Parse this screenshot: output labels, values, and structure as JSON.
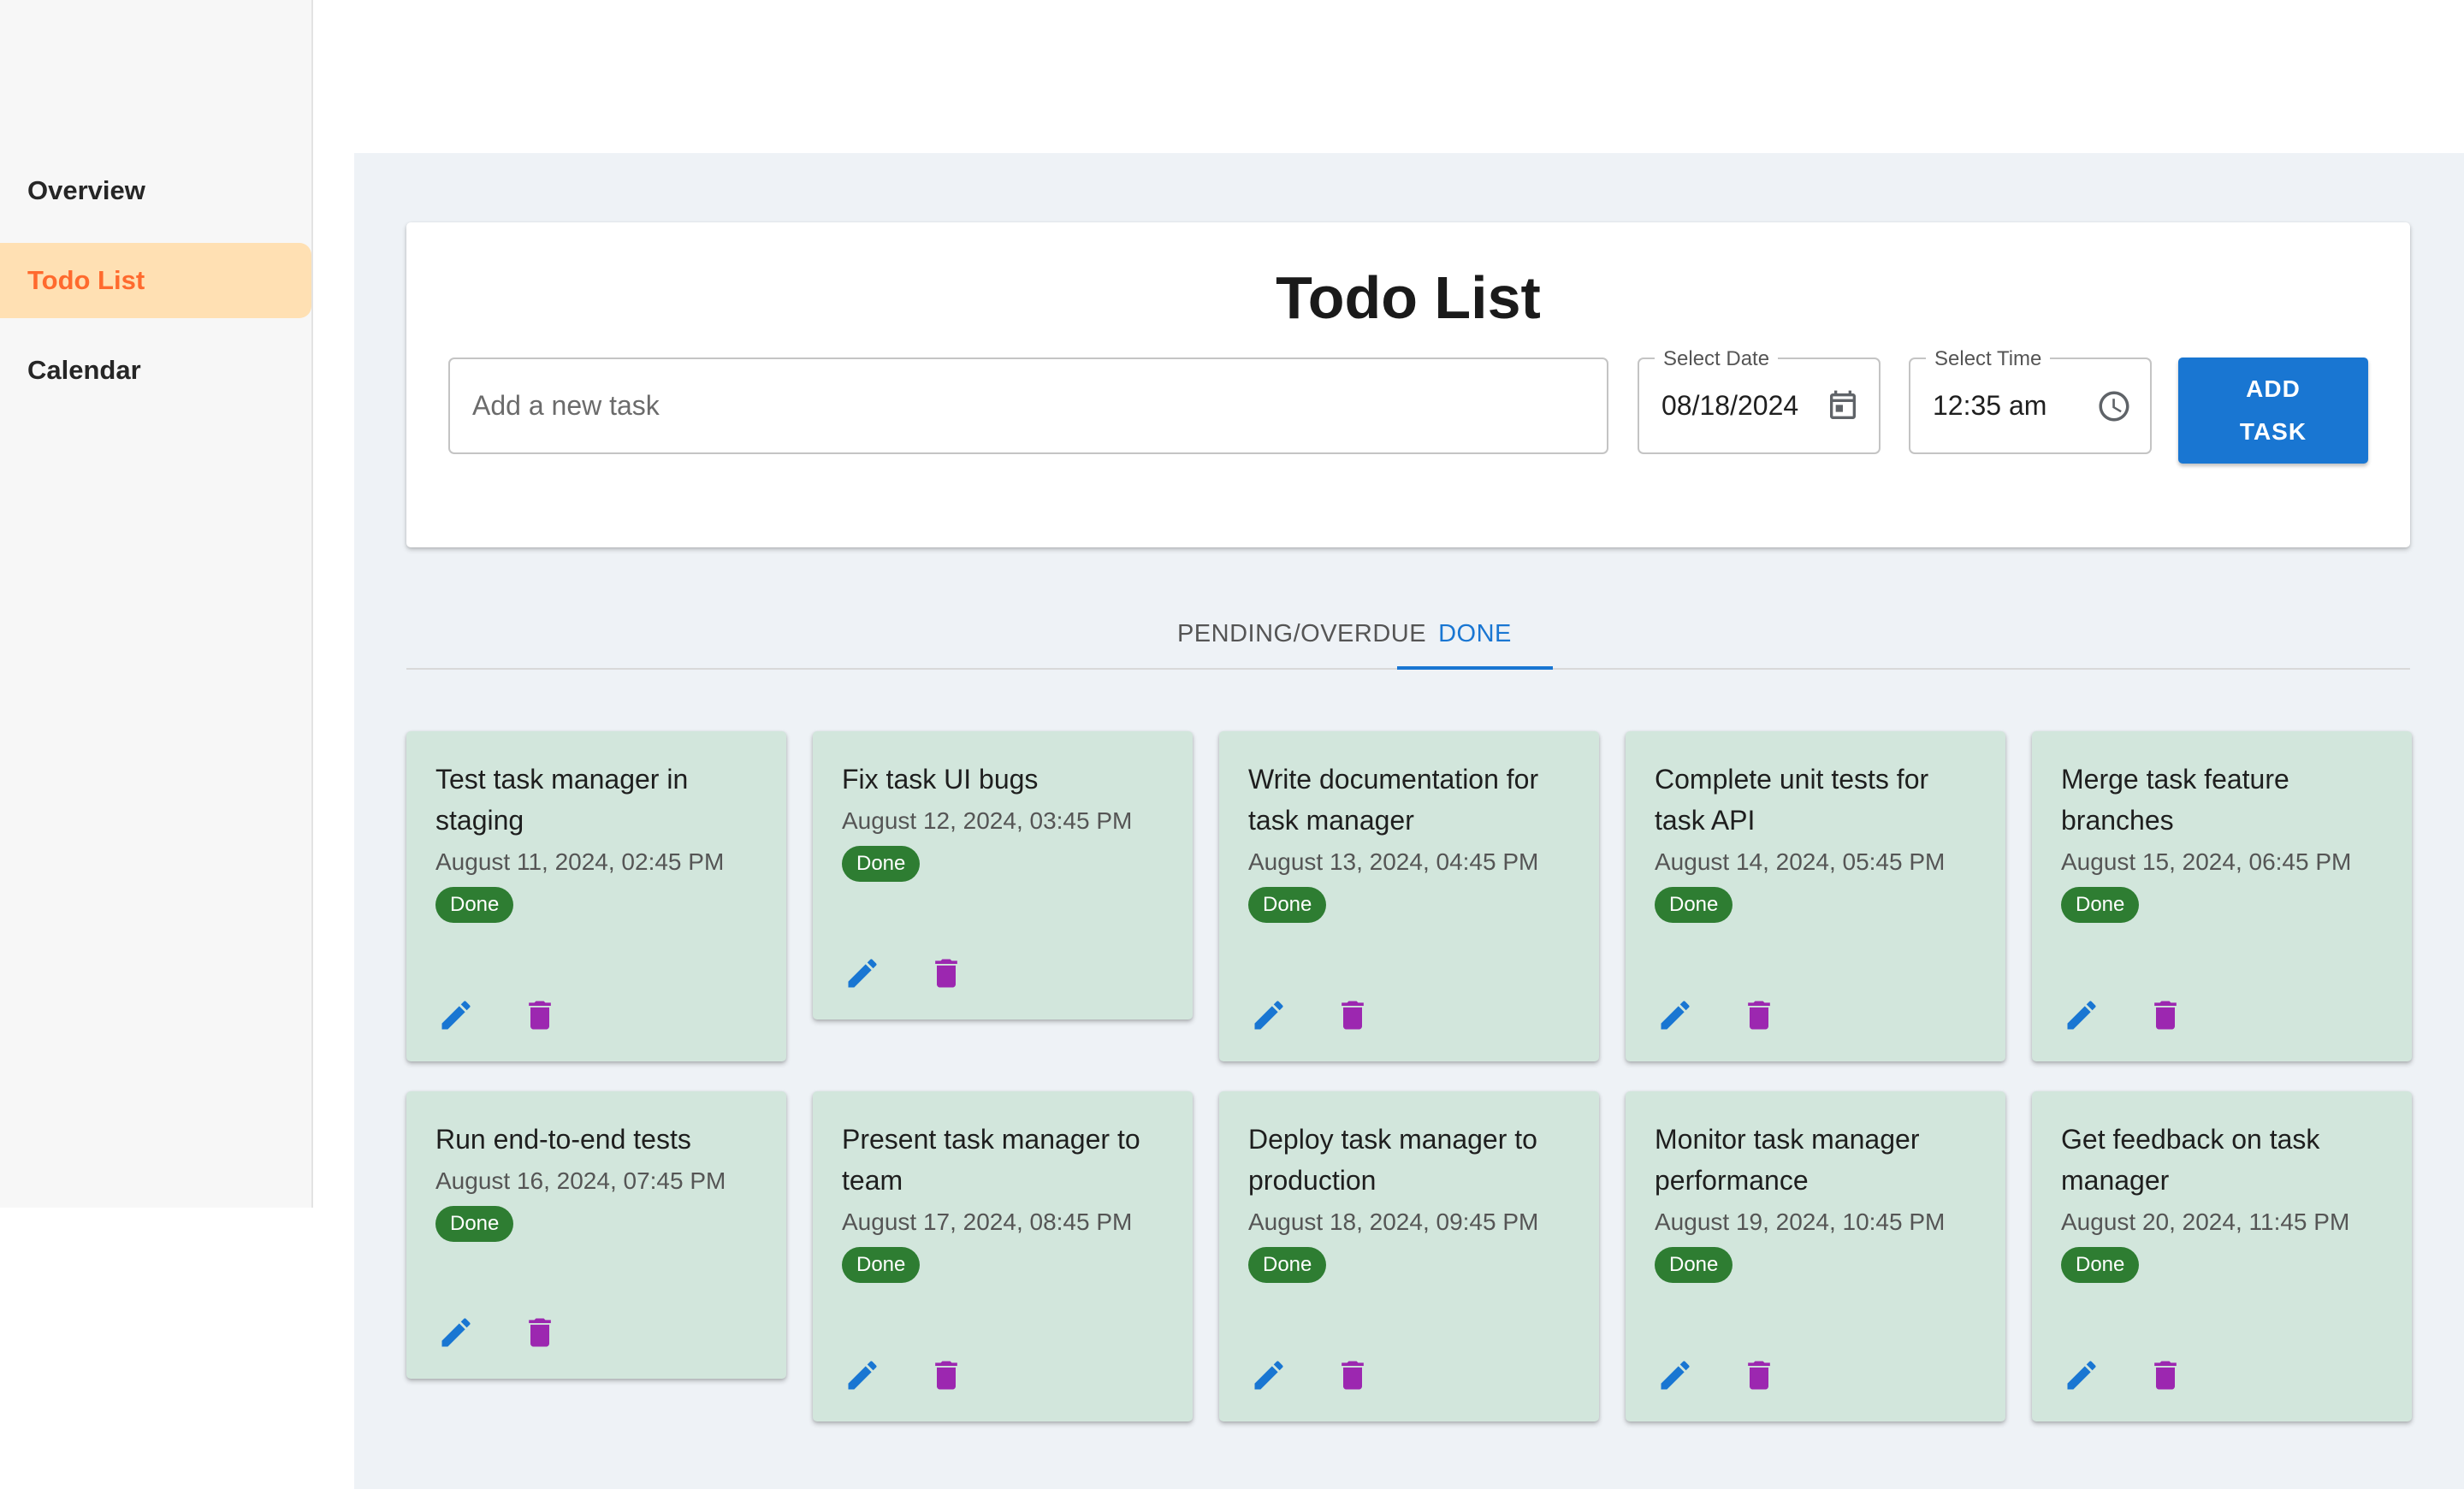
{
  "sidebar": {
    "items": [
      {
        "label": "Overview",
        "active": false
      },
      {
        "label": "Todo List",
        "active": true
      },
      {
        "label": "Calendar",
        "active": false
      }
    ]
  },
  "header": {
    "title": "Todo List",
    "task_input_placeholder": "Add a new task",
    "date_field": {
      "label": "Select Date",
      "value": "08/18/2024",
      "icon": "calendar-icon"
    },
    "time_field": {
      "label": "Select Time",
      "value": "12:35 am",
      "icon": "clock-icon"
    },
    "add_button_label": "ADD TASK"
  },
  "tabs": [
    {
      "label": "PENDING/OVERDUE",
      "active": false
    },
    {
      "label": "DONE",
      "active": true
    }
  ],
  "tasks": [
    {
      "title": "Test task manager in staging",
      "date": "August 11, 2024, 02:45 PM",
      "status": "Done"
    },
    {
      "title": "Fix task UI bugs",
      "date": "August 12, 2024, 03:45 PM",
      "status": "Done"
    },
    {
      "title": "Write documentation for task manager",
      "date": "August 13, 2024, 04:45 PM",
      "status": "Done"
    },
    {
      "title": "Complete unit tests for task API",
      "date": "August 14, 2024, 05:45 PM",
      "status": "Done"
    },
    {
      "title": "Merge task feature branches",
      "date": "August 15, 2024, 06:45 PM",
      "status": "Done"
    },
    {
      "title": "Run end-to-end tests",
      "date": "August 16, 2024, 07:45 PM",
      "status": "Done"
    },
    {
      "title": "Present task manager to team",
      "date": "August 17, 2024, 08:45 PM",
      "status": "Done"
    },
    {
      "title": "Deploy task manager to production",
      "date": "August 18, 2024, 09:45 PM",
      "status": "Done"
    },
    {
      "title": "Monitor task manager performance",
      "date": "August 19, 2024, 10:45 PM",
      "status": "Done"
    },
    {
      "title": "Get feedback on task manager",
      "date": "August 20, 2024, 11:45 PM",
      "status": "Done"
    }
  ],
  "colors": {
    "accent": "#1976d2",
    "sidebar_active_bg": "#ffe0b3",
    "sidebar_active_text": "#ff6a2e",
    "card_bg": "#d2e6dc",
    "done_badge": "#2e7d32",
    "edit_icon": "#1976d2",
    "delete_icon": "#9c27b0"
  }
}
